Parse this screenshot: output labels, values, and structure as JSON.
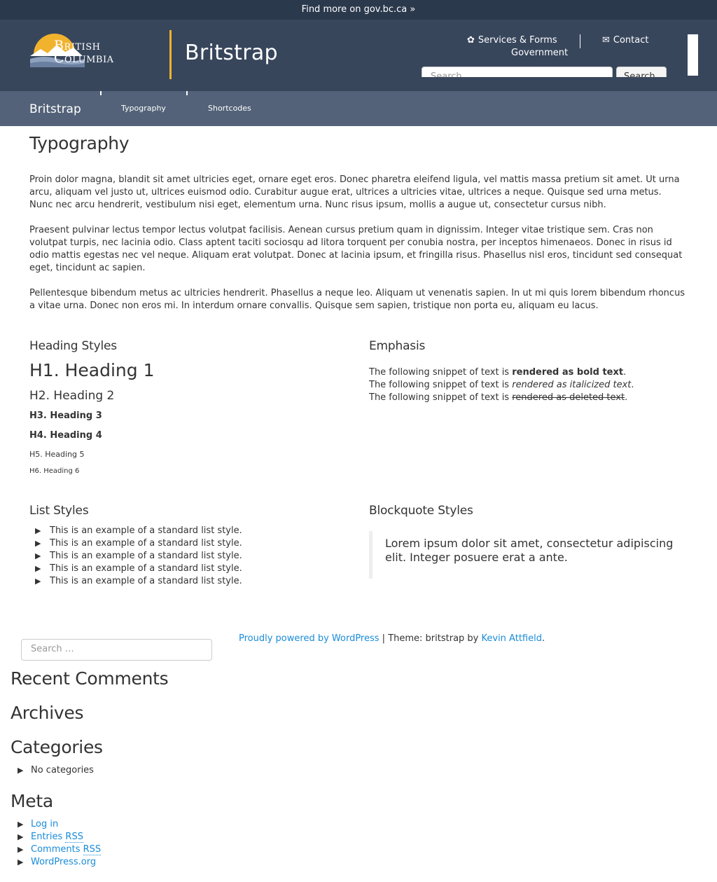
{
  "topbar": {
    "link": "Find more on gov.bc.ca »"
  },
  "header": {
    "logo_line1": "British",
    "logo_line2": "Columbia",
    "site_title": "Britstrap",
    "services_label": "Services & Forms",
    "government_label": "Government",
    "contact_label": "Contact",
    "search_placeholder": "Search",
    "search_button": "Search",
    "colors": {
      "topbar": "#2b394d",
      "header": "#38465c",
      "accent": "#f1b22d",
      "navbar": "#536278"
    }
  },
  "navbar": {
    "brand": "Britstrap",
    "links": [
      "Typography",
      "Shortcodes"
    ]
  },
  "main": {
    "title": "Typography",
    "paragraphs": [
      "Proin dolor magna, blandit sit amet ultricies eget, ornare eget eros. Donec pharetra eleifend ligula, vel mattis massa pretium sit amet. Ut urna arcu, aliquam vel justo ut, ultrices euismod odio. Curabitur augue erat, ultrices a ultricies vitae, ultrices a neque. Quisque sed urna metus. Nunc nec arcu hendrerit, vestibulum nisi eget, elementum urna. Nunc risus ipsum, mollis a augue ut, consectetur cursus nibh.",
      "Praesent pulvinar lectus tempor lectus volutpat facilisis. Aenean cursus pretium quam in dignissim. Integer vitae tristique sem. Cras non volutpat turpis, nec lacinia odio. Class aptent taciti sociosqu ad litora torquent per conubia nostra, per inceptos himenaeos. Donec in risus id odio mattis egestas nec vel neque. Aliquam erat volutpat. Donec at lacinia ipsum, et fringilla risus. Phasellus nisl eros, tincidunt sed consequat eget, tincidunt ac sapien.",
      "Pellentesque bibendum metus ac ultricies hendrerit. Phasellus a neque leo. Aliquam ut venenatis sapien. In ut mi quis lorem bibendum rhoncus a vitae urna. Donec non eros mi. In interdum ornare convallis. Quisque sem sapien, tristique non porta eu, aliquam eu lacus."
    ],
    "heading_styles": {
      "title": "Heading Styles",
      "h1": "H1. Heading 1",
      "h2": "H2. Heading 2",
      "h3": "H3. Heading 3",
      "h4": "H4. Heading 4",
      "h5": "H5. Heading 5",
      "h6": "H6. Heading 6"
    },
    "emphasis": {
      "title": "Emphasis",
      "prefix": "The following snippet of text is ",
      "bold": "rendered as bold text",
      "italic": "rendered as italicized text",
      "deleted": "rendered as deleted text",
      "suffix": "."
    },
    "list_styles": {
      "title": "List Styles",
      "items": [
        "This is an example of a standard list style.",
        "This is an example of a standard list style.",
        "This is an example of a standard list style.",
        "This is an example of a standard list style.",
        "This is an example of a standard list style."
      ]
    },
    "blockquote": {
      "title": "Blockquote Styles",
      "text": "Lorem ipsum dolor sit amet, consectetur adipiscing elit. Integer posuere erat a ante."
    }
  },
  "footer": {
    "powered": "Proudly powered by WordPress",
    "theme_text": " | Theme: britstrap by ",
    "author": "Kevin Attfield",
    "end": "."
  },
  "sidebar": {
    "search_placeholder": "Search …",
    "recent_comments": "Recent Comments",
    "archives": "Archives",
    "categories": "Categories",
    "categories_items": [
      "No categories"
    ],
    "meta": "Meta",
    "meta_items": {
      "login": "Log in",
      "entries": "Entries",
      "comments": "Comments",
      "rss": "RSS",
      "wordpress": "WordPress.org"
    }
  }
}
